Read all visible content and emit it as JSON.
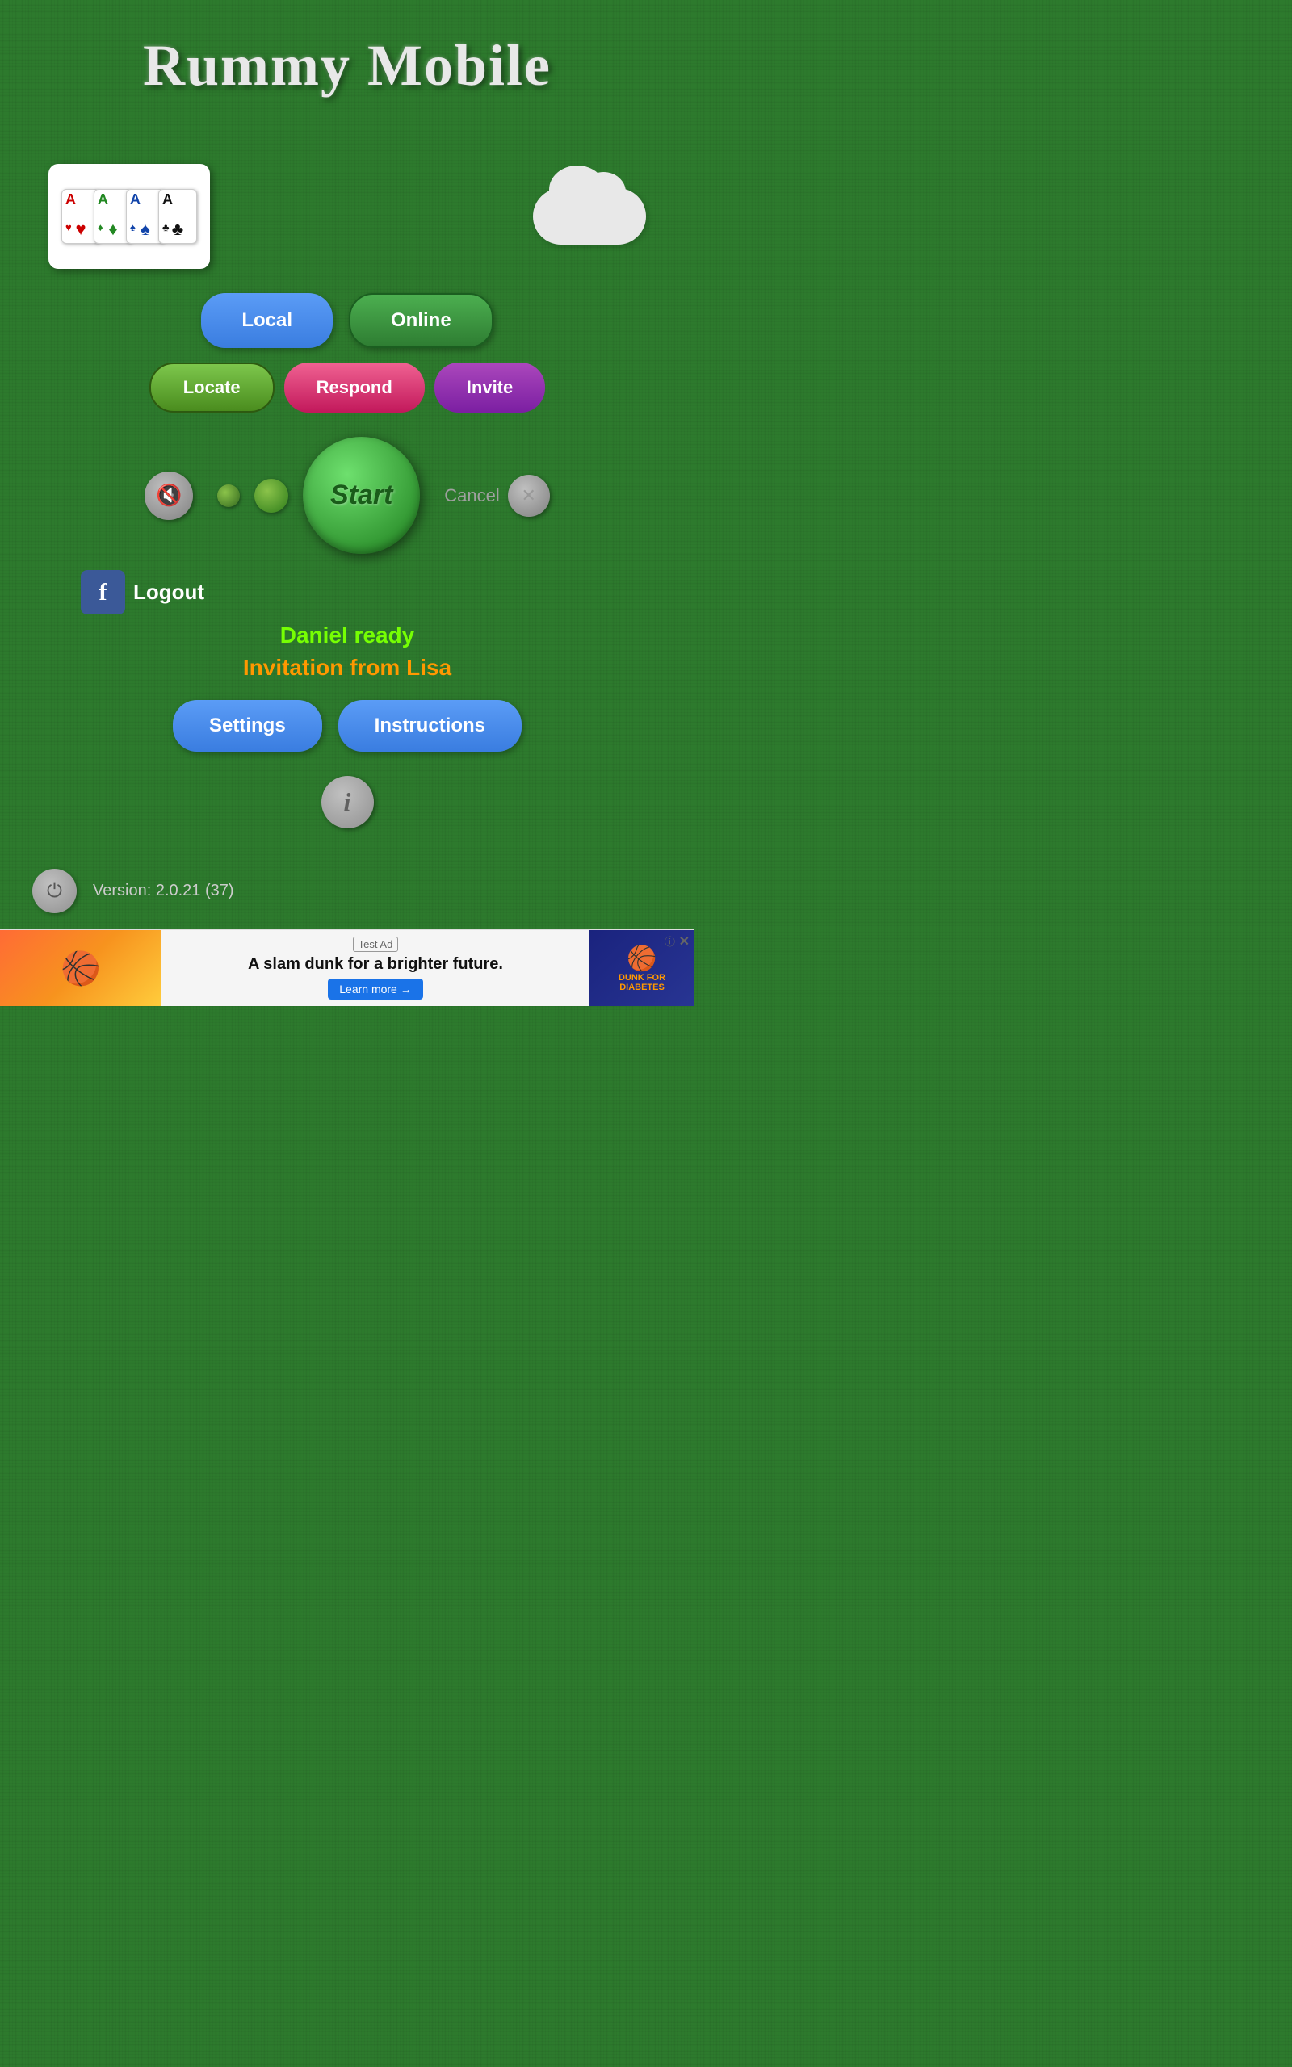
{
  "title": "Rummy Mobile",
  "cards": [
    {
      "letter": "A",
      "suit": "♥",
      "color": "#cc0000"
    },
    {
      "letter": "A",
      "suit": "♦",
      "color": "#228822"
    },
    {
      "letter": "A",
      "suit": "♠",
      "color": "#1144aa"
    },
    {
      "letter": "A",
      "suit": "♣",
      "color": "#111111"
    }
  ],
  "buttons": {
    "local": "Local",
    "online": "Online",
    "locate": "Locate",
    "respond": "Respond",
    "invite": "Invite",
    "start": "Start",
    "cancel": "Cancel",
    "logout": "Logout",
    "settings": "Settings",
    "instructions": "Instructions",
    "learn_more": "Learn more →"
  },
  "status": {
    "daniel_ready": "Daniel ready",
    "invitation": "Invitation from Lisa"
  },
  "version": "Version: 2.0.21 (37)",
  "ad": {
    "tag": "Test Ad",
    "headline": "A slam dunk for a brighter future.",
    "logo": "DUNK FOR DIABETES",
    "learn_more": "Learn more →"
  }
}
